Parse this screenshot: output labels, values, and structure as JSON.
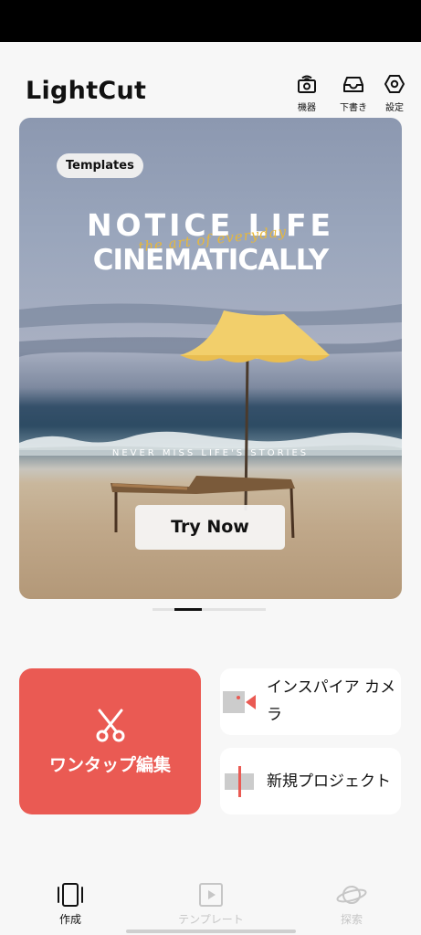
{
  "header": {
    "app_title": "LightCut",
    "devices_label": "機器",
    "drafts_label": "下書き",
    "settings_label": "設定"
  },
  "banner": {
    "tag": "Templates",
    "headline_line1": "NOTICE LIFE",
    "headline_line2": "CINEMATICALLY",
    "script_text": "the art of everyday",
    "tagline": "NEVER MISS LIFE'S STORIES",
    "cta": "Try Now",
    "slide_count": 4,
    "active_slide": 1
  },
  "actions": {
    "one_tap_edit": "ワンタップ編集",
    "inspire_camera": "インスパイア カメラ",
    "new_project": "新規プロジェクト"
  },
  "tabs": {
    "create": "作成",
    "templates": "テンプレート",
    "explore": "探索"
  },
  "colors": {
    "accent_red": "#ea5a53",
    "active_tab": "#111111",
    "inactive_tab": "#c6c6c6"
  }
}
